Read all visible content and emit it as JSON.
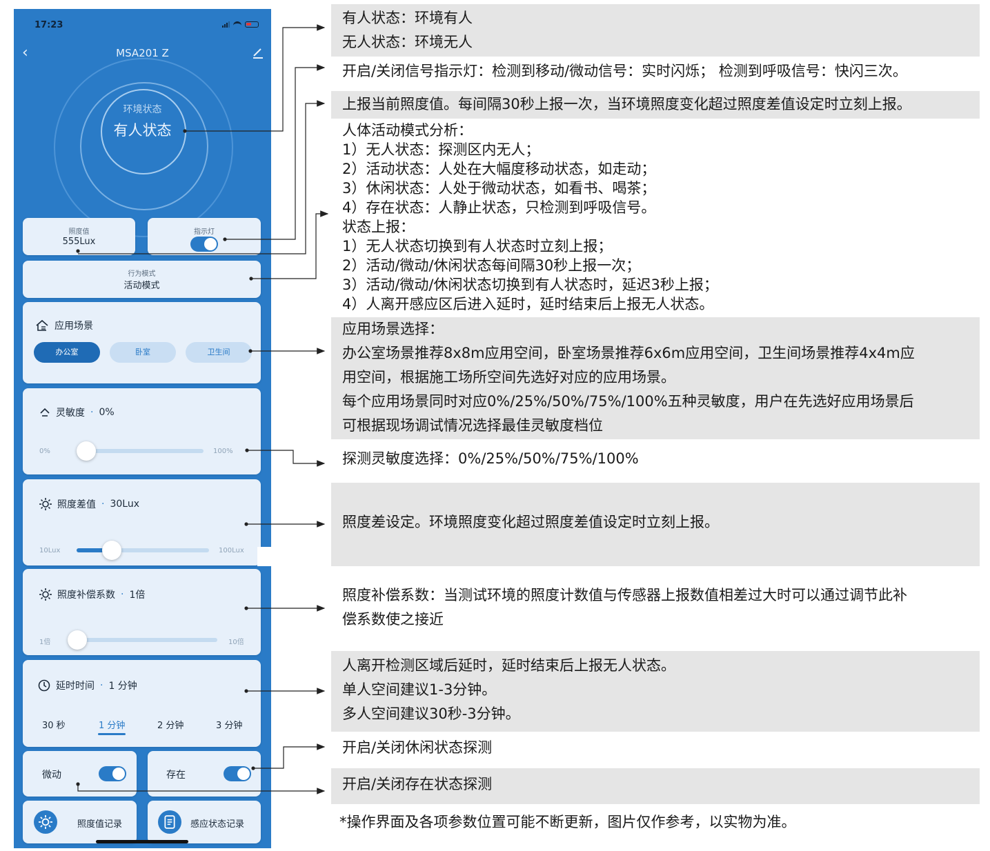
{
  "statusbar": {
    "time": "17:23"
  },
  "nav": {
    "title": "MSA201 Z"
  },
  "env": {
    "label": "环境状态",
    "value": "有人状态"
  },
  "lux_card": {
    "label": "照度值",
    "value": "555Lux"
  },
  "indicator_card": {
    "label": "指示灯",
    "on": true
  },
  "mode_card": {
    "label": "行为模式",
    "value": "活动模式"
  },
  "scene": {
    "title": "应用场景",
    "options": [
      "办公室",
      "卧室",
      "卫生间"
    ],
    "selected": "办公室"
  },
  "sensitivity": {
    "title": "灵敏度",
    "value": "0%",
    "min": "0%",
    "max": "100%",
    "level": 0
  },
  "lux_diff": {
    "title": "照度差值",
    "value": "30Lux",
    "min": "10Lux",
    "max": "100Lux",
    "level": 0.3
  },
  "lux_comp": {
    "title": "照度补偿系数",
    "value": "1倍",
    "min": "1倍",
    "max": "10倍",
    "level": 0
  },
  "delay": {
    "title": "延时时间",
    "value": "1 分钟",
    "options": [
      "30 秒",
      "1 分钟",
      "2 分钟",
      "3 分钟"
    ],
    "selected_index": 1
  },
  "micro_toggle": {
    "label": "微动",
    "on": true
  },
  "presence_toggle": {
    "label": "存在",
    "on": true
  },
  "records": {
    "lux_record": "照度值记录",
    "state_record": "感应状态记录"
  },
  "annotations": {
    "env_state": [
      "有人状态：环境有人",
      "无人状态：环境无人"
    ],
    "indicator": "开启/关闭信号指示灯：检测到移动/微动信号：实时闪烁；  检测到呼吸信号：快闪三次。",
    "lux_report": "上报当前照度值。每间隔30秒上报一次，当环境照度变化超过照度差值设定时立刻上报。",
    "mode": [
      "人体活动模式分析：",
      "1）无人状态：探测区内无人；",
      "2）活动状态：人处在大幅度移动状态，如走动；",
      "3）休闲状态：人处于微动状态，如看书、喝茶；",
      "4）存在状态：人静止状态，只检测到呼吸信号。",
      "状态上报：",
      "1）无人状态切换到有人状态时立刻上报；",
      "2）活动/微动/休闲状态每间隔30秒上报一次；",
      "3）活动/微动/休闲状态切换到有人状态时，延迟3秒上报；",
      "4）人离开感应区后进入延时，延时结束后上报无人状态。"
    ],
    "scene": [
      "应用场景选择：",
      "办公室场景推荐8x8m应用空间，卧室场景推荐6x6m应用空间，卫生间场景推荐4x4m应",
      "用空间，根据施工场所空间先选好对应的应用场景。",
      "每个应用场景同时对应0%/25%/50%/75%/100%五种灵敏度，用户在先选好应用场景后",
      "可根据现场调试情况选择最佳灵敏度档位"
    ],
    "sensitivity": "探测灵敏度选择：0%/25%/50%/75%/100%",
    "lux_diff": "照度差设定。环境照度变化超过照度差值设定时立刻上报。",
    "lux_comp": [
      "照度补偿系数：当测试环境的照度计数值与传感器上报数值相差过大时可以通过调节此补",
      "偿系数使之接近"
    ],
    "delay": [
      "人离开检测区域后延时，延时结束后上报无人状态。",
      "单人空间建议1-3分钟。",
      "多人空间建议30秒-3分钟。"
    ],
    "micro": "开启/关闭休闲状态探测",
    "presence": "开启/关闭存在状态探测",
    "footnote": "*操作界面及各项参数位置可能不断更新，图片仅作参考，以实物为准。"
  }
}
